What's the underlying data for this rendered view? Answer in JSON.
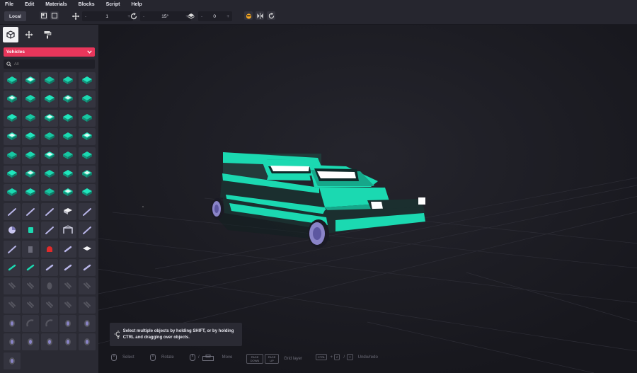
{
  "menu": [
    "File",
    "Edit",
    "Materials",
    "Blocks",
    "Script",
    "Help"
  ],
  "toolbar": {
    "space_label": "Local",
    "move_step": "1",
    "rotate_step": "15°",
    "layer": "0",
    "minus": "-",
    "plus": "+"
  },
  "panel": {
    "category": "Vehicles",
    "search_placeholder": "All"
  },
  "tooltip": "Select multiple objects by holding SHIFT, or by holding CTRL and dragging over objects.",
  "hints": {
    "select": "Select",
    "rotate": "Rotate",
    "slash": "/",
    "move": "Move",
    "pgdown": "PAGE DOWN",
    "pgup": "PAGE UP",
    "grid_layer": "Grid layer",
    "ctrl": "CTRL",
    "plus": "+",
    "z": "Z",
    "y": "Y",
    "undoredo": "Undo/redo"
  },
  "colors": {
    "accent": "#e8365b",
    "teal": "#1bd9b1",
    "panel": "#2a2a33"
  },
  "palette": {
    "count": 76
  }
}
